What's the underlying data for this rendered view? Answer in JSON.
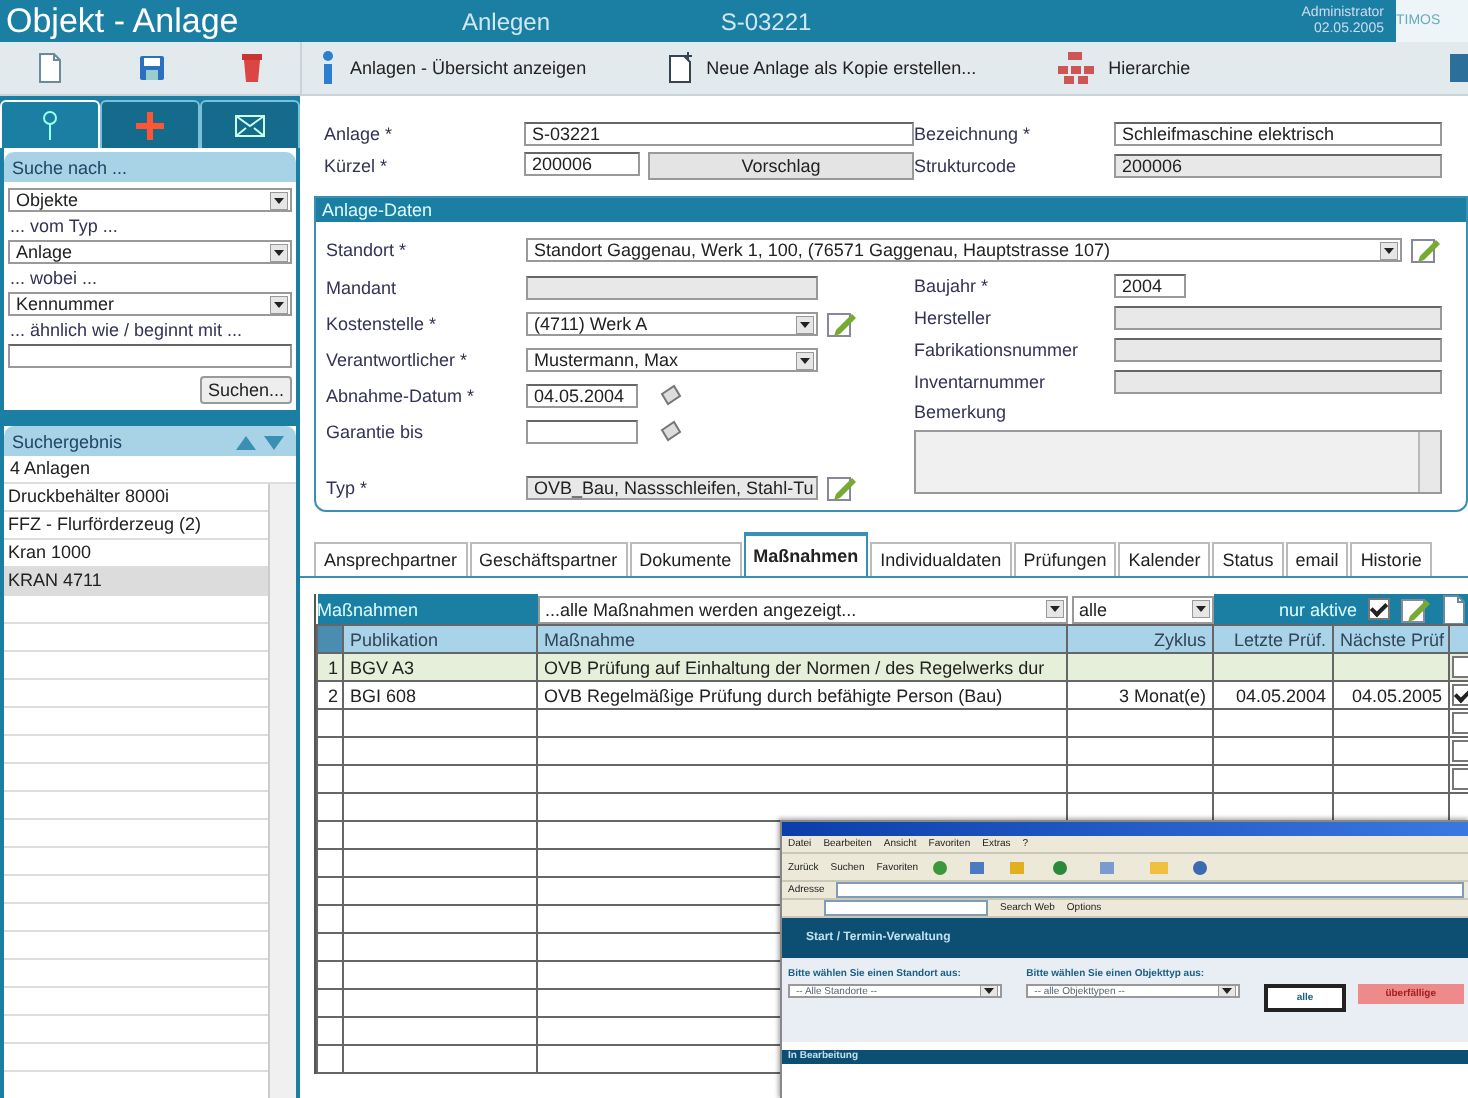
{
  "header": {
    "title": "Objekt - Anlage",
    "mode": "Anlegen",
    "number": "S-03221",
    "user": "Administrator",
    "date": "02.05.2005",
    "logo": "TIMOS"
  },
  "toolbar": {
    "actions": [
      {
        "kind": "info",
        "label": "Anlagen - Übersicht anzeigen"
      },
      {
        "kind": "copy",
        "label": "Neue Anlage als Kopie erstellen..."
      },
      {
        "kind": "hierarchy",
        "label": "Hierarchie"
      }
    ]
  },
  "sidebar": {
    "tools": [
      {
        "kind": "new"
      },
      {
        "kind": "save"
      },
      {
        "kind": "delete"
      }
    ],
    "tabs": [
      {
        "kind": "search",
        "selected": true
      },
      {
        "kind": "new",
        "selected": false
      },
      {
        "kind": "mail",
        "selected": false
      }
    ],
    "search": {
      "title": "Suche nach ...",
      "object_select": "Objekte",
      "type_label": "... vom Typ ...",
      "type_select": "Anlage",
      "where_label": "... wobei ...",
      "field_select": "Kennummer",
      "match_label": "... ähnlich wie / beginnt mit ...",
      "button": "Suchen..."
    },
    "results": {
      "title": "Suchergebnis",
      "count": "4 Anlagen",
      "items": [
        {
          "label": "Druckbehälter 8000i",
          "selected": false
        },
        {
          "label": "FFZ - Flurförderzeug (2)",
          "selected": false
        },
        {
          "label": "Kran 1000",
          "selected": false
        },
        {
          "label": "KRAN 4711",
          "selected": true
        }
      ]
    }
  },
  "head_fields": {
    "anlage": {
      "label": "Anlage *",
      "value": "S-03221"
    },
    "kuerzel": {
      "label": "Kürzel *",
      "value": "200006"
    },
    "suggest_button": "Vorschlag",
    "bezeichnung": {
      "label": "Bezeichnung *",
      "value": "Schleifmaschine elektrisch"
    },
    "strukturcode": {
      "label": "Strukturcode",
      "value": "200006"
    }
  },
  "anlage_daten": {
    "title": "Anlage-Daten",
    "standort": {
      "label": "Standort *",
      "value": "Standort Gaggenau, Werk 1, 100, (76571 Gaggenau, Hauptstrasse 107)",
      "kind": "select",
      "edit_button": true
    },
    "left": [
      {
        "label": "Mandant",
        "kind": "readonly",
        "edit_button": false
      },
      {
        "label": "Kostenstelle *",
        "value": "(4711) Werk A",
        "kind": "select",
        "edit_button": true
      },
      {
        "label": "Verantwortlicher *",
        "value": "Mustermann, Max",
        "kind": "select",
        "edit_button": false
      },
      {
        "label": "Abnahme-Datum *",
        "value": "04.05.2004",
        "kind": "date",
        "edit_button": false
      },
      {
        "label": "Garantie bis",
        "kind": "date",
        "edit_button": false
      },
      {
        "label": "Typ *",
        "value": "OVB_Bau, Nassschleifen, Stahl-Tu",
        "kind": "readonly",
        "edit_button": true
      }
    ],
    "right": [
      {
        "label": "Baujahr *",
        "value": "2004",
        "kind": "short"
      },
      {
        "label": "Hersteller",
        "kind": "text"
      },
      {
        "label": "Fabrikationsnummer",
        "kind": "text"
      },
      {
        "label": "Inventarnummer",
        "kind": "text"
      },
      {
        "label": "Bemerkung",
        "kind": "textarea"
      }
    ]
  },
  "tabs": [
    {
      "label": "Ansprechpartner",
      "selected": false
    },
    {
      "label": "Geschäftspartner",
      "selected": false
    },
    {
      "label": "Dokumente",
      "selected": false
    },
    {
      "label": "Maßnahmen",
      "selected": true
    },
    {
      "label": "Individualdaten",
      "selected": false
    },
    {
      "label": "Prüfungen",
      "selected": false
    },
    {
      "label": "Kalender",
      "selected": false
    },
    {
      "label": "Status",
      "selected": false
    },
    {
      "label": "email",
      "selected": false
    },
    {
      "label": "Historie",
      "selected": false
    }
  ],
  "table": {
    "title": "Maßnahmen",
    "filter_select": "...alle Maßnahmen werden angezeigt...",
    "cycle_select": "alle",
    "active_only": {
      "label": "nur aktive",
      "checked": true
    },
    "columns": [
      "Publikation",
      "Maßnahme",
      "Zyklus",
      "Letzte Prüf.",
      "Nächste Prüf"
    ],
    "rows": [
      {
        "no": "1",
        "cells": [
          "BGV A3",
          "OVB Prüfung auf Einhaltung der Normen / des Regelwerks dur",
          "",
          "",
          ""
        ],
        "highlighted": true,
        "checked": false
      },
      {
        "no": "2",
        "cells": [
          "BGI 608",
          "OVB Regelmäßige Prüfung durch befähigte Person (Bau)",
          "3  Monat(e)",
          "04.05.2004",
          "04.05.2005"
        ],
        "highlighted": false,
        "checked": true
      },
      {
        "checked": false
      },
      {
        "checked": false
      },
      {
        "checked": false
      }
    ]
  },
  "inset": {
    "menu": [
      "Datei",
      "Bearbeiten",
      "Ansicht",
      "Favoriten",
      "Extras",
      "?"
    ],
    "toolbar": [
      "Zurück",
      "Suchen",
      "Favoriten"
    ],
    "address_label": "Adresse",
    "google_items": [
      "Search Web",
      "Options"
    ],
    "breadcrumb": "Start / Termin-Verwaltung",
    "standort_label": "Bitte wählen Sie einen Standort aus:",
    "standort_select": "-- Alle Standorte --",
    "typ_label": "Bitte wählen Sie einen Objekttyp aus:",
    "typ_select": "-- alle Objekttypen --",
    "buttons": [
      {
        "label": "alle",
        "kind": "outline"
      },
      {
        "label": "überfällige",
        "kind": "alert"
      }
    ],
    "section": "In Bearbeitung"
  }
}
